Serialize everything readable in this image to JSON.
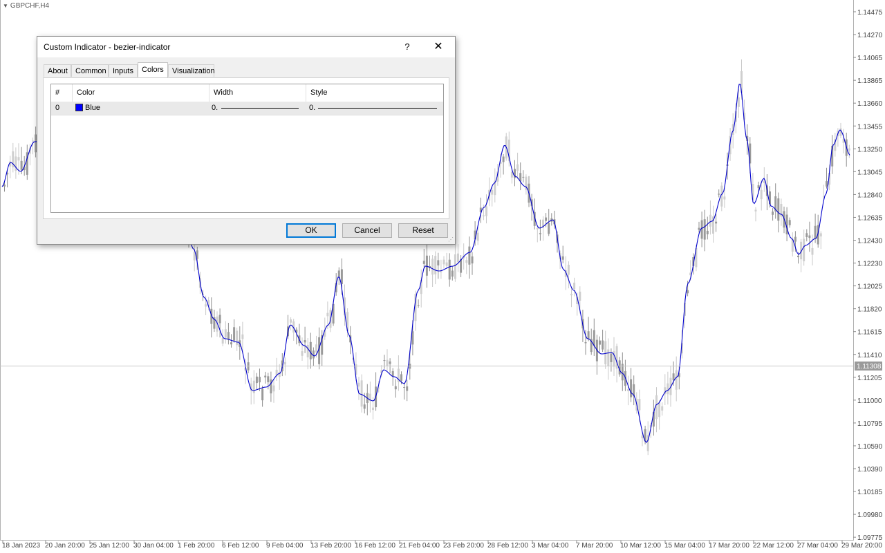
{
  "chart": {
    "symbol": "GBPCHF,H4",
    "current_price": "1.11308",
    "price_labels": [
      "1.14475",
      "1.14270",
      "1.14065",
      "1.13865",
      "1.13660",
      "1.13455",
      "1.13250",
      "1.13045",
      "1.12840",
      "1.12635",
      "1.12430",
      "1.12230",
      "1.12025",
      "1.11820",
      "1.11615",
      "1.11410",
      "1.11205",
      "1.11000",
      "1.10795",
      "1.10590",
      "1.10390",
      "1.10185",
      "1.09980",
      "1.09775"
    ],
    "time_labels": [
      "18 Jan 2023",
      "20 Jan 20:00",
      "25 Jan 12:00",
      "30 Jan 04:00",
      "1 Feb 20:00",
      "6 Feb 12:00",
      "9 Feb 04:00",
      "13 Feb 20:00",
      "16 Feb 12:00",
      "21 Feb 04:00",
      "23 Feb 20:00",
      "28 Feb 12:00",
      "3 Mar 04:00",
      "7 Mar 20:00",
      "10 Mar 12:00",
      "15 Mar 04:00",
      "17 Mar 20:00",
      "22 Mar 12:00",
      "27 Mar 04:00",
      "29 Mar 20:00"
    ],
    "indicator_color": "#0000cc",
    "candle_color": "#9a9a9a"
  },
  "dialog": {
    "title": "Custom Indicator - bezier-indicator",
    "help": "?",
    "close": "✕",
    "tabs": [
      "About",
      "Common",
      "Inputs",
      "Colors",
      "Visualization"
    ],
    "active_tab": "Colors",
    "grid": {
      "headers": [
        "#",
        "Color",
        "Width",
        "Style"
      ],
      "rows": [
        {
          "index": "0",
          "color_name": "Blue",
          "color_hex": "#0000ff",
          "width": "0.",
          "style": "0."
        }
      ]
    },
    "buttons": {
      "ok": "OK",
      "cancel": "Cancel",
      "reset": "Reset"
    }
  }
}
